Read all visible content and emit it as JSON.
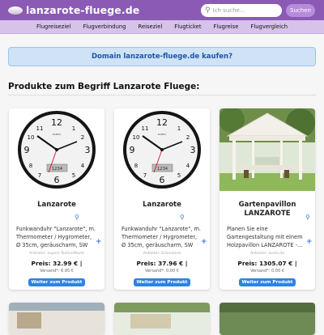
{
  "header": {
    "brand": "lanzarote-fluege.de",
    "search_placeholder": "Ich suche...",
    "search_button": "Suchen"
  },
  "nav": {
    "items": [
      "Flugreiseziel",
      "Flugverbindung",
      "Reiseziel",
      "Flugticket",
      "Flugreise",
      "Flugvergleich"
    ]
  },
  "domain_banner": "Domain lanzarote-fluege.de kaufen?",
  "section_title": "Produkte zum Begriff Lanzarote Fluege:",
  "products": [
    {
      "title": "Lanzarote",
      "description": "Funkwanduhr \"Lanzarote\", m. Thermometer / Hygrometer, Ø 35cm, geräuscharm, SW",
      "seller": "Anbieter: expert TechnoMarkt",
      "price": "Preis: 32.99 € |",
      "shipping": "Versand*: 6.95 €",
      "button": "Weiter zum Produkt",
      "clock_brand": "KAMEA",
      "clock_display": "1234"
    },
    {
      "title": "Lanzarote",
      "description": "Funkwanduhr \"Lanzarote\", m. Thermometer / Hygrometer, Ø 35cm, geräuscharm, SW",
      "seller": "Anbieter: Eizenstore",
      "price": "Preis: 37.96 € |",
      "shipping": "Versand*: 0.00 €",
      "button": "Weiter zum Produkt",
      "clock_brand": "KAMEA",
      "clock_display": "1234"
    },
    {
      "title": "Gartenpavillon LANZAROTE",
      "description": "Planen Sie eine Gartengestaltung mit einem Holzpavillon LANZAROTE -...",
      "seller": "Anbieter: avelo.de",
      "price": "Preis: 1305.07 € |",
      "shipping": "Versand*: 0.00 €",
      "button": "Weiter zum Produkt"
    }
  ],
  "colors": {
    "header": "#8a5ab5",
    "nav": "#d7c2ea",
    "button": "#2d82e3",
    "banner": "#cfe2f6",
    "banner_text": "#1c57a8"
  },
  "icons": {
    "search": "magnifier",
    "zoom": "magnifier",
    "expand": "plus"
  }
}
